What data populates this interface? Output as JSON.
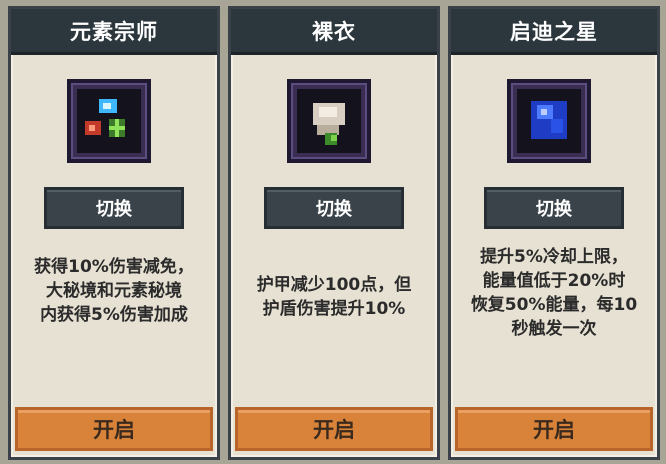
{
  "cards": [
    {
      "title": "元素宗师",
      "icon": "element-master-icon",
      "switch_label": "切换",
      "description": [
        "获得10%伤害减免，",
        "大秘境和元素秘境",
        "内获得5%伤害加成"
      ],
      "open_label": "开启"
    },
    {
      "title": "裸衣",
      "icon": "bare-cloth-icon",
      "switch_label": "切换",
      "description": [
        "护甲减少100点，但",
        "护盾伤害提升10%"
      ],
      "open_label": "开启"
    },
    {
      "title": "启迪之星",
      "icon": "star-of-enlightenment-icon",
      "switch_label": "切换",
      "description": [
        "提升5%冷却上限，",
        "能量值低于20%时",
        "恢复50%能量，每10",
        "秒触发一次"
      ],
      "open_label": "开启"
    }
  ],
  "colors": {
    "header_bg": "#2b363d",
    "card_bg": "#e6e1d2",
    "switch_bg": "#3a4349",
    "open_bg": "#d9833a",
    "icon_frame": "#3a2d52"
  }
}
